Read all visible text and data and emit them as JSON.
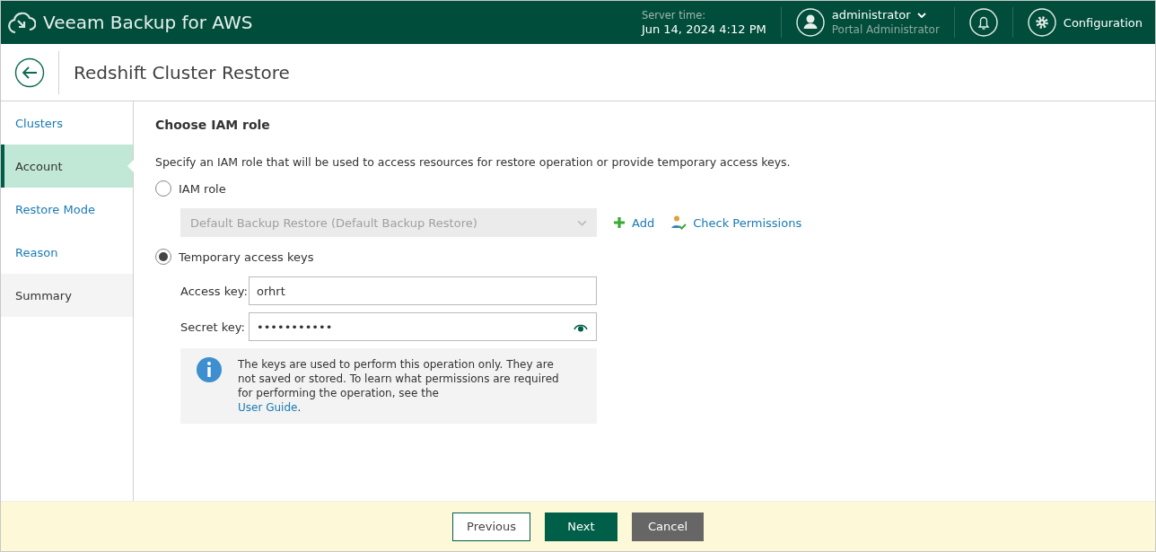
{
  "app": {
    "title": "Veeam Backup for AWS",
    "server_time_label": "Server time:",
    "server_time": "Jun 14, 2024 4:12 PM",
    "user": {
      "name": "administrator",
      "role": "Portal Administrator"
    },
    "configuration": "Configuration"
  },
  "page": {
    "title": "Redshift Cluster Restore"
  },
  "steps": [
    {
      "label": "Clusters",
      "selected": false,
      "visited": true
    },
    {
      "label": "Account",
      "selected": true,
      "visited": true
    },
    {
      "label": "Restore Mode",
      "selected": false,
      "visited": true
    },
    {
      "label": "Reason",
      "selected": false,
      "visited": true
    },
    {
      "label": "Summary",
      "selected": false,
      "visited": false
    }
  ],
  "section": {
    "title": "Choose IAM role",
    "description": "Specify an IAM role that will be used to access resources for restore operation or provide temporary access keys."
  },
  "options": [
    {
      "label": "IAM role",
      "selected": false
    },
    {
      "label": "Temporary access keys",
      "selected": true
    }
  ],
  "role_select": {
    "value": "Default Backup Restore (Default Backup Restore)",
    "disabled": true
  },
  "role_actions": {
    "add": "Add",
    "check": "Check Permissions"
  },
  "access_key": {
    "label": "Access key:",
    "value": "orhrt"
  },
  "secret_key": {
    "label": "Secret key:",
    "value": "•••••••••••"
  },
  "info": {
    "text": "The keys are used to perform this operation only. They are not saved or stored. To learn what permissions are required for performing the operation, see the",
    "link": "User Guide",
    "after_link": "."
  },
  "buttons": {
    "previous": "Previous",
    "next": "Next",
    "cancel": "Cancel"
  }
}
